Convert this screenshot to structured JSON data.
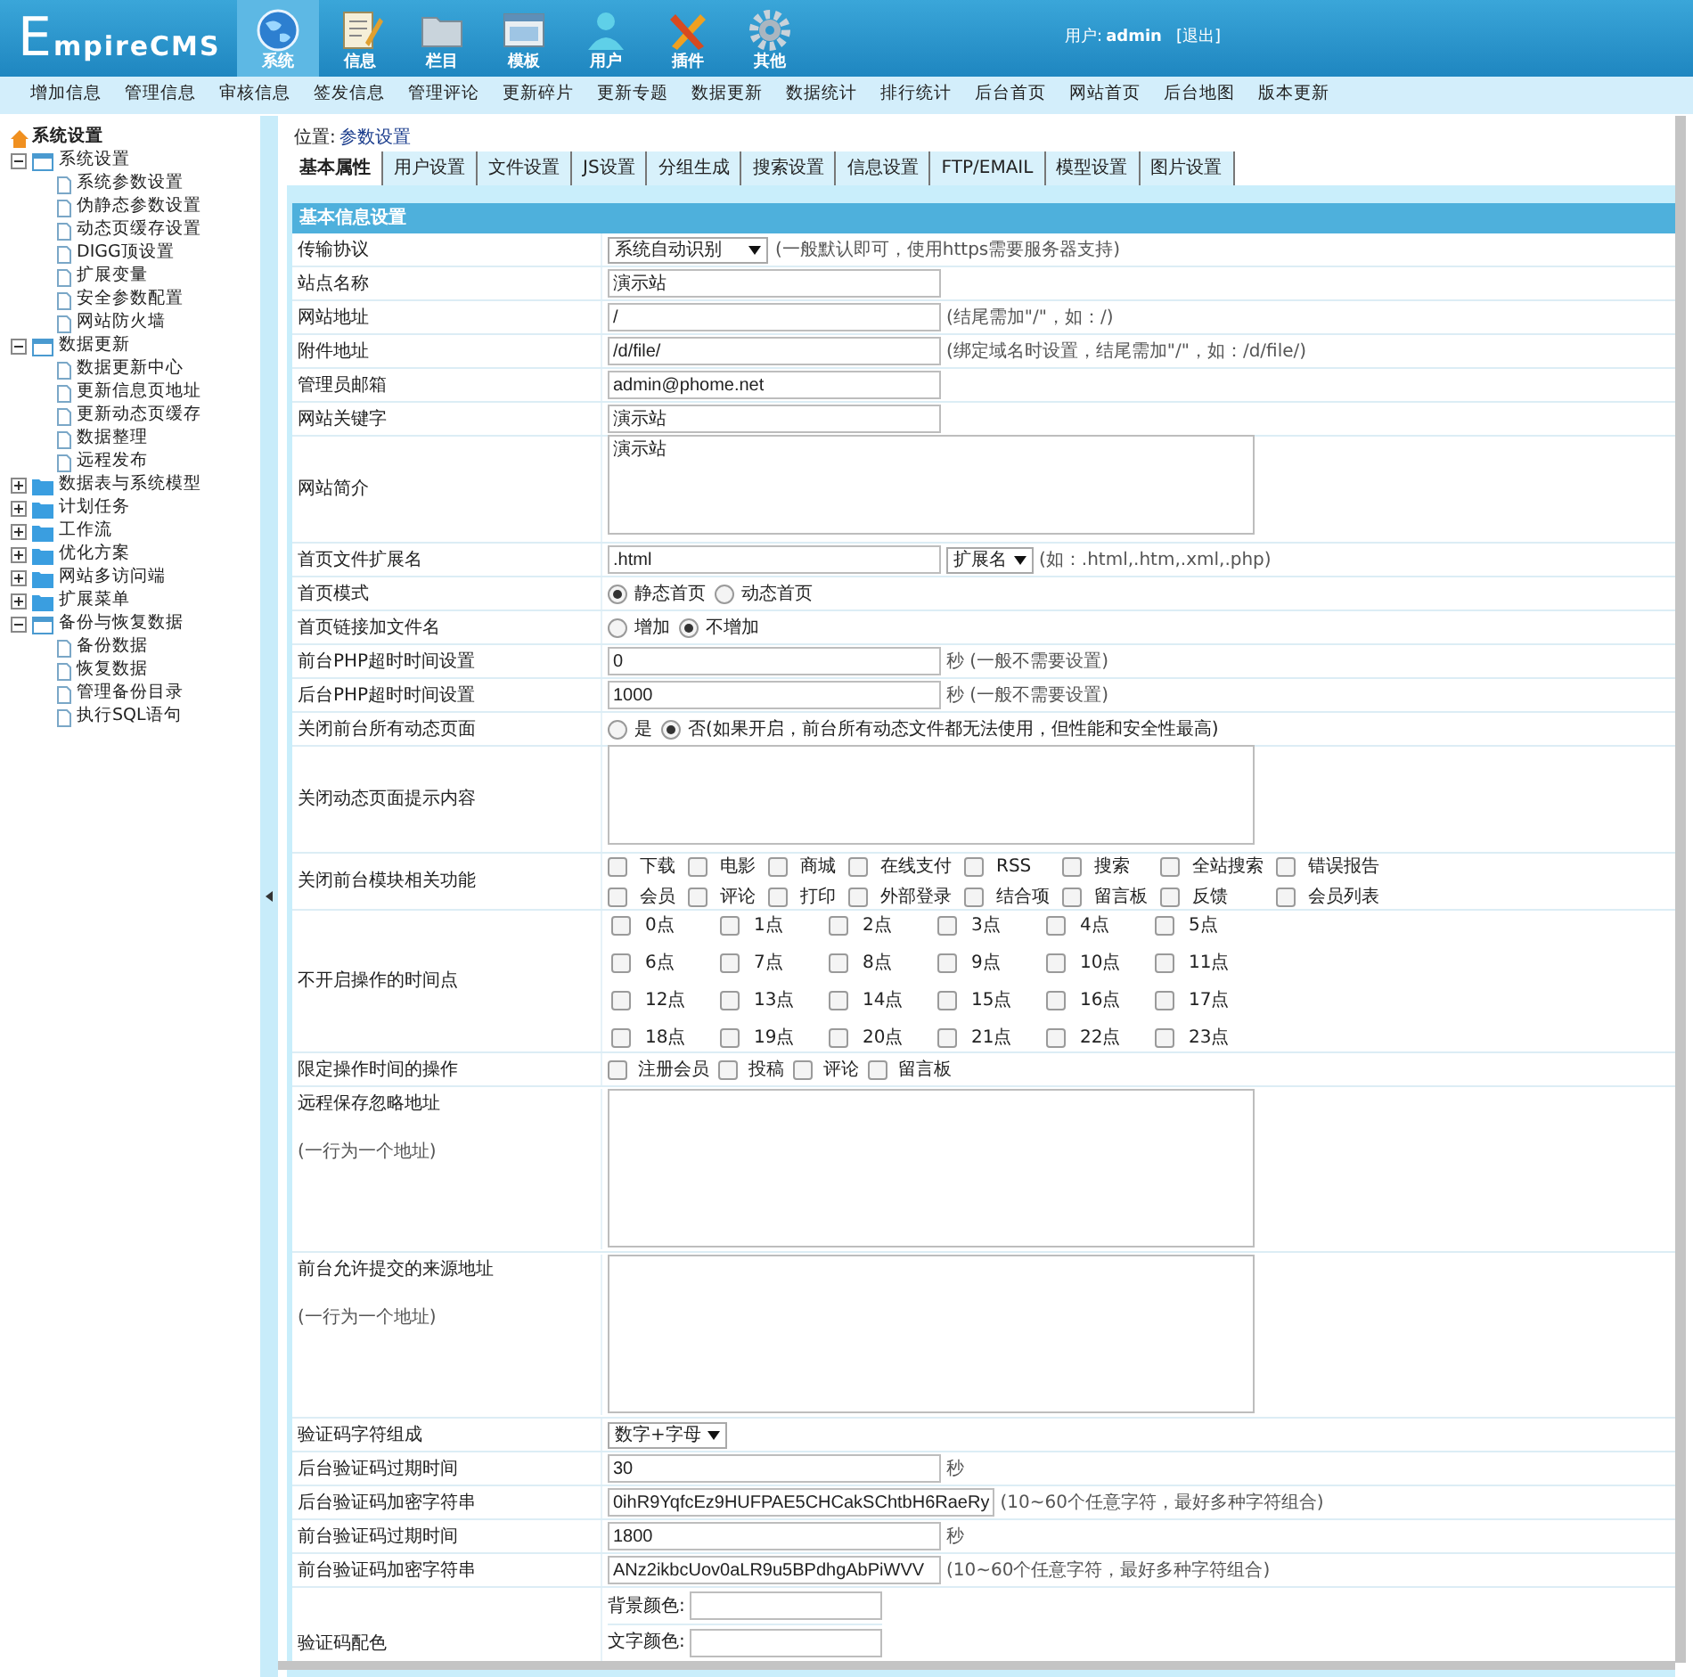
{
  "header": {
    "logo": "EmpireCMS",
    "top_tabs": [
      {
        "label": "系统",
        "kind": "globe",
        "selected": true
      },
      {
        "label": "信息",
        "kind": "notepad",
        "selected": false
      },
      {
        "label": "栏目",
        "kind": "folder",
        "selected": false
      },
      {
        "label": "模板",
        "kind": "window",
        "selected": false
      },
      {
        "label": "用户",
        "kind": "person",
        "selected": false
      },
      {
        "label": "插件",
        "kind": "tools",
        "selected": false
      },
      {
        "label": "其他",
        "kind": "gear",
        "selected": false
      }
    ],
    "user_label": "用户:",
    "user_name": "admin",
    "logout": "[退出]"
  },
  "menu": [
    "增加信息",
    "管理信息",
    "审核信息",
    "签发信息",
    "管理评论",
    "更新碎片",
    "更新专题",
    "数据更新",
    "数据统计",
    "排行统计",
    "后台首页",
    "网站首页",
    "后台地图",
    "版本更新"
  ],
  "sidebar": {
    "root": "系统设置",
    "groups": [
      {
        "label": "系统设置",
        "expanded": true,
        "children": [
          "系统参数设置",
          "伪静态参数设置",
          "动态页缓存设置",
          "DIGG顶设置",
          "扩展变量",
          "安全参数配置",
          "网站防火墙"
        ]
      },
      {
        "label": "数据更新",
        "expanded": true,
        "children": [
          "数据更新中心",
          "更新信息页地址",
          "更新动态页缓存",
          "数据整理",
          "远程发布"
        ]
      },
      {
        "label": "数据表与系统模型",
        "expanded": false
      },
      {
        "label": "计划任务",
        "expanded": false
      },
      {
        "label": "工作流",
        "expanded": false
      },
      {
        "label": "优化方案",
        "expanded": false
      },
      {
        "label": "网站多访问端",
        "expanded": false
      },
      {
        "label": "扩展菜单",
        "expanded": false
      },
      {
        "label": "备份与恢复数据",
        "expanded": true,
        "children": [
          "备份数据",
          "恢复数据",
          "管理备份目录",
          "执行SQL语句"
        ]
      }
    ]
  },
  "location": {
    "label": "位置:",
    "link": "参数设置"
  },
  "tabs": [
    {
      "label": "基本属性",
      "selected": true
    },
    {
      "label": "用户设置",
      "selected": false
    },
    {
      "label": "文件设置",
      "selected": false
    },
    {
      "label": "JS设置",
      "selected": false
    },
    {
      "label": "分组生成",
      "selected": false
    },
    {
      "label": "搜索设置",
      "selected": false
    },
    {
      "label": "信息设置",
      "selected": false
    },
    {
      "label": "FTP/EMAIL",
      "selected": false
    },
    {
      "label": "模型设置",
      "selected": false
    },
    {
      "label": "图片设置",
      "selected": false
    }
  ],
  "section_title": "基本信息设置",
  "rows": [
    {
      "label": "传输协议",
      "kind": "select",
      "value": "系统自动识别",
      "note": "(一般默认即可，使用https需要服务器支持)"
    },
    {
      "label": "站点名称",
      "kind": "text",
      "value": "演示站"
    },
    {
      "label": "网站地址",
      "kind": "text",
      "value": "/",
      "note": "(结尾需加\"/\"，如：/)"
    },
    {
      "label": "附件地址",
      "kind": "text",
      "value": "/d/file/",
      "note": "(绑定域名时设置，结尾需加\"/\"，如：/d/file/)"
    },
    {
      "label": "管理员邮箱",
      "kind": "text",
      "value": "admin@phome.net"
    },
    {
      "label": "网站关键字",
      "kind": "text",
      "value": "演示站"
    },
    {
      "label": "网站简介",
      "kind": "textarea",
      "value": "演示站"
    },
    {
      "label": "首页文件扩展名",
      "kind": "text_select",
      "value": ".html",
      "select": "扩展名",
      "note": "(如：.html,.htm,.xml,.php)"
    },
    {
      "label": "首页模式",
      "kind": "radios",
      "options": [
        {
          "label": "静态首页",
          "selected": true
        },
        {
          "label": "动态首页",
          "selected": false
        }
      ]
    },
    {
      "label": "首页链接加文件名",
      "kind": "radios",
      "options": [
        {
          "label": "增加",
          "selected": false
        },
        {
          "label": "不增加",
          "selected": true
        }
      ]
    },
    {
      "label": "前台PHP超时时间设置",
      "kind": "text",
      "value": "0",
      "note": "秒 (一般不需要设置)"
    },
    {
      "label": "后台PHP超时时间设置",
      "kind": "text",
      "value": "1000",
      "note": "秒 (一般不需要设置)"
    },
    {
      "label": "关闭前台所有动态页面",
      "kind": "radios",
      "options": [
        {
          "label": "是",
          "selected": false
        },
        {
          "label": "否(如果开启，前台所有动态文件都无法使用，但性能和安全性最高)",
          "selected": true
        }
      ]
    },
    {
      "label": "关闭动态页面提示内容",
      "kind": "textarea"
    },
    {
      "label": "关闭前台模块相关功能",
      "kind": "check_table",
      "options": [
        {
          "label": "下载",
          "checked": false
        },
        {
          "label": "电影",
          "checked": false
        },
        {
          "label": "商城",
          "checked": false
        },
        {
          "label": "在线支付",
          "checked": false
        },
        {
          "label": "RSS",
          "checked": false
        },
        {
          "label": "搜索",
          "checked": false
        },
        {
          "label": "全站搜索",
          "checked": false
        },
        {
          "label": "错误报告",
          "checked": false
        },
        {
          "label": "会员",
          "checked": false
        },
        {
          "label": "评论",
          "checked": false
        },
        {
          "label": "打印",
          "checked": false
        },
        {
          "label": "外部登录",
          "checked": false
        },
        {
          "label": "结合项",
          "checked": false
        },
        {
          "label": "留言板",
          "checked": false
        },
        {
          "label": "反馈",
          "checked": false
        },
        {
          "label": "会员列表",
          "checked": false
        }
      ]
    },
    {
      "label": "不开启操作的时间点",
      "kind": "hour_grid",
      "options": [
        {
          "label": "0点",
          "checked": false
        },
        {
          "label": "1点",
          "checked": false
        },
        {
          "label": "2点",
          "checked": false
        },
        {
          "label": "3点",
          "checked": false
        },
        {
          "label": "4点",
          "checked": false
        },
        {
          "label": "5点",
          "checked": false
        },
        {
          "label": "6点",
          "checked": false
        },
        {
          "label": "7点",
          "checked": false
        },
        {
          "label": "8点",
          "checked": false
        },
        {
          "label": "9点",
          "checked": false
        },
        {
          "label": "10点",
          "checked": false
        },
        {
          "label": "11点",
          "checked": false
        },
        {
          "label": "12点",
          "checked": false
        },
        {
          "label": "13点",
          "checked": false
        },
        {
          "label": "14点",
          "checked": false
        },
        {
          "label": "15点",
          "checked": false
        },
        {
          "label": "16点",
          "checked": false
        },
        {
          "label": "17点",
          "checked": false
        },
        {
          "label": "18点",
          "checked": false
        },
        {
          "label": "19点",
          "checked": false
        },
        {
          "label": "20点",
          "checked": false
        },
        {
          "label": "21点",
          "checked": false
        },
        {
          "label": "22点",
          "checked": false
        },
        {
          "label": "23点",
          "checked": false
        }
      ]
    },
    {
      "label": "限定操作时间的操作",
      "kind": "checks",
      "options": [
        {
          "label": "注册会员",
          "checked": false
        },
        {
          "label": "投稿",
          "checked": false
        },
        {
          "label": "评论",
          "checked": false
        },
        {
          "label": "留言板",
          "checked": false
        }
      ]
    },
    {
      "label": "远程保存忽略地址",
      "kind": "textarea",
      "sublabel": "(一行为一个地址)"
    },
    {
      "label": "前台允许提交的来源地址",
      "kind": "textarea",
      "sublabel": "(一行为一个地址)"
    },
    {
      "label": "验证码字符组成",
      "kind": "select",
      "value": "数字+字母"
    },
    {
      "label": "后台验证码过期时间",
      "kind": "text",
      "value": "30",
      "note": "秒"
    },
    {
      "label": "后台验证码加密字符串",
      "kind": "text",
      "value": "0ihR9YqfcEz9HUFPAE5CHCakSChtbH6RaeRy",
      "note": "(10~60个任意字符，最好多种字符组合)"
    },
    {
      "label": "前台验证码过期时间",
      "kind": "text",
      "value": "1800",
      "note": "秒"
    },
    {
      "label": "前台验证码加密字符串",
      "kind": "text",
      "value": "ANz2ikbcUov0aLR9u5BPdhgAbPiWVV",
      "note": "(10~60个任意字符，最好多种字符组合)"
    },
    {
      "label": "验证码配色",
      "kind": "colors",
      "fields": [
        "背景颜色:",
        "文字颜色:"
      ]
    }
  ]
}
